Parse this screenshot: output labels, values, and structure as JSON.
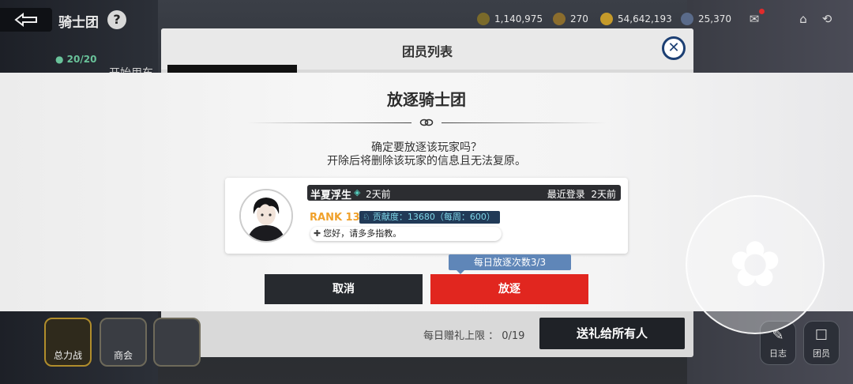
{
  "topbar": {
    "title": "骑士团",
    "help": "?",
    "resources": [
      {
        "icon": "coin-stack-icon",
        "value": "1,140,975",
        "color": "#7a6a2a"
      },
      {
        "icon": "potion-icon",
        "value": "270",
        "color": "#8b6d2d"
      },
      {
        "icon": "gold-coin-icon",
        "value": "54,642,193",
        "color": "#c59a2a"
      },
      {
        "icon": "drop-icon",
        "value": "25,370",
        "color": "#5a6b8a"
      }
    ]
  },
  "background": {
    "member_count": "20/20",
    "behind_name": "开始用车",
    "panel_title": "团员列表",
    "gift_limit": "每日赠礼上限 ： 0/19",
    "gift_all": "送礼给所有人",
    "left_icons": [
      "总力战",
      "商会",
      ""
    ],
    "right_icons": [
      "日志",
      "团员"
    ]
  },
  "modal": {
    "title": "放逐骑士团",
    "confirm_line1": "确定要放逐该玩家吗？",
    "confirm_line2": "开除后将删除该玩家的信息且无法复原。",
    "player": {
      "name": "半夏浮生",
      "online_ago": "2天前",
      "last_login_label": "最近登录",
      "last_login_value": "2天前",
      "rank": "RANK 13",
      "contribution": "贡献度：13680（每周：600）",
      "message": "您好，请多多指教。"
    },
    "daily_expel": "每日放逐次数3/3",
    "cancel": "取消",
    "expel": "放逐"
  },
  "colors": {
    "accent_red": "#e1261f",
    "rank_orange": "#f0a12b",
    "tooltip_blue": "#5f86b8"
  }
}
